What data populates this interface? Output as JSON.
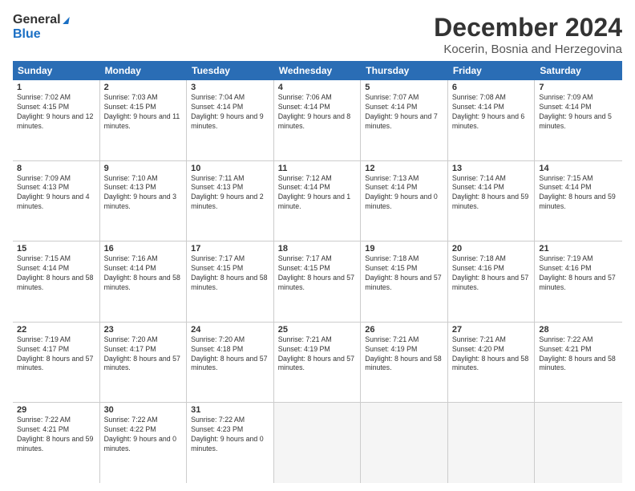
{
  "logo": {
    "line1": "General",
    "line2": "Blue"
  },
  "title": "December 2024",
  "subtitle": "Kocerin, Bosnia and Herzegovina",
  "weekdays": [
    "Sunday",
    "Monday",
    "Tuesday",
    "Wednesday",
    "Thursday",
    "Friday",
    "Saturday"
  ],
  "weeks": [
    [
      {
        "day": "1",
        "sunrise": "Sunrise: 7:02 AM",
        "sunset": "Sunset: 4:15 PM",
        "daylight": "Daylight: 9 hours and 12 minutes."
      },
      {
        "day": "2",
        "sunrise": "Sunrise: 7:03 AM",
        "sunset": "Sunset: 4:15 PM",
        "daylight": "Daylight: 9 hours and 11 minutes."
      },
      {
        "day": "3",
        "sunrise": "Sunrise: 7:04 AM",
        "sunset": "Sunset: 4:14 PM",
        "daylight": "Daylight: 9 hours and 9 minutes."
      },
      {
        "day": "4",
        "sunrise": "Sunrise: 7:06 AM",
        "sunset": "Sunset: 4:14 PM",
        "daylight": "Daylight: 9 hours and 8 minutes."
      },
      {
        "day": "5",
        "sunrise": "Sunrise: 7:07 AM",
        "sunset": "Sunset: 4:14 PM",
        "daylight": "Daylight: 9 hours and 7 minutes."
      },
      {
        "day": "6",
        "sunrise": "Sunrise: 7:08 AM",
        "sunset": "Sunset: 4:14 PM",
        "daylight": "Daylight: 9 hours and 6 minutes."
      },
      {
        "day": "7",
        "sunrise": "Sunrise: 7:09 AM",
        "sunset": "Sunset: 4:14 PM",
        "daylight": "Daylight: 9 hours and 5 minutes."
      }
    ],
    [
      {
        "day": "8",
        "sunrise": "Sunrise: 7:09 AM",
        "sunset": "Sunset: 4:13 PM",
        "daylight": "Daylight: 9 hours and 4 minutes."
      },
      {
        "day": "9",
        "sunrise": "Sunrise: 7:10 AM",
        "sunset": "Sunset: 4:13 PM",
        "daylight": "Daylight: 9 hours and 3 minutes."
      },
      {
        "day": "10",
        "sunrise": "Sunrise: 7:11 AM",
        "sunset": "Sunset: 4:13 PM",
        "daylight": "Daylight: 9 hours and 2 minutes."
      },
      {
        "day": "11",
        "sunrise": "Sunrise: 7:12 AM",
        "sunset": "Sunset: 4:14 PM",
        "daylight": "Daylight: 9 hours and 1 minute."
      },
      {
        "day": "12",
        "sunrise": "Sunrise: 7:13 AM",
        "sunset": "Sunset: 4:14 PM",
        "daylight": "Daylight: 9 hours and 0 minutes."
      },
      {
        "day": "13",
        "sunrise": "Sunrise: 7:14 AM",
        "sunset": "Sunset: 4:14 PM",
        "daylight": "Daylight: 8 hours and 59 minutes."
      },
      {
        "day": "14",
        "sunrise": "Sunrise: 7:15 AM",
        "sunset": "Sunset: 4:14 PM",
        "daylight": "Daylight: 8 hours and 59 minutes."
      }
    ],
    [
      {
        "day": "15",
        "sunrise": "Sunrise: 7:15 AM",
        "sunset": "Sunset: 4:14 PM",
        "daylight": "Daylight: 8 hours and 58 minutes."
      },
      {
        "day": "16",
        "sunrise": "Sunrise: 7:16 AM",
        "sunset": "Sunset: 4:14 PM",
        "daylight": "Daylight: 8 hours and 58 minutes."
      },
      {
        "day": "17",
        "sunrise": "Sunrise: 7:17 AM",
        "sunset": "Sunset: 4:15 PM",
        "daylight": "Daylight: 8 hours and 58 minutes."
      },
      {
        "day": "18",
        "sunrise": "Sunrise: 7:17 AM",
        "sunset": "Sunset: 4:15 PM",
        "daylight": "Daylight: 8 hours and 57 minutes."
      },
      {
        "day": "19",
        "sunrise": "Sunrise: 7:18 AM",
        "sunset": "Sunset: 4:15 PM",
        "daylight": "Daylight: 8 hours and 57 minutes."
      },
      {
        "day": "20",
        "sunrise": "Sunrise: 7:18 AM",
        "sunset": "Sunset: 4:16 PM",
        "daylight": "Daylight: 8 hours and 57 minutes."
      },
      {
        "day": "21",
        "sunrise": "Sunrise: 7:19 AM",
        "sunset": "Sunset: 4:16 PM",
        "daylight": "Daylight: 8 hours and 57 minutes."
      }
    ],
    [
      {
        "day": "22",
        "sunrise": "Sunrise: 7:19 AM",
        "sunset": "Sunset: 4:17 PM",
        "daylight": "Daylight: 8 hours and 57 minutes."
      },
      {
        "day": "23",
        "sunrise": "Sunrise: 7:20 AM",
        "sunset": "Sunset: 4:17 PM",
        "daylight": "Daylight: 8 hours and 57 minutes."
      },
      {
        "day": "24",
        "sunrise": "Sunrise: 7:20 AM",
        "sunset": "Sunset: 4:18 PM",
        "daylight": "Daylight: 8 hours and 57 minutes."
      },
      {
        "day": "25",
        "sunrise": "Sunrise: 7:21 AM",
        "sunset": "Sunset: 4:19 PM",
        "daylight": "Daylight: 8 hours and 57 minutes."
      },
      {
        "day": "26",
        "sunrise": "Sunrise: 7:21 AM",
        "sunset": "Sunset: 4:19 PM",
        "daylight": "Daylight: 8 hours and 58 minutes."
      },
      {
        "day": "27",
        "sunrise": "Sunrise: 7:21 AM",
        "sunset": "Sunset: 4:20 PM",
        "daylight": "Daylight: 8 hours and 58 minutes."
      },
      {
        "day": "28",
        "sunrise": "Sunrise: 7:22 AM",
        "sunset": "Sunset: 4:21 PM",
        "daylight": "Daylight: 8 hours and 58 minutes."
      }
    ],
    [
      {
        "day": "29",
        "sunrise": "Sunrise: 7:22 AM",
        "sunset": "Sunset: 4:21 PM",
        "daylight": "Daylight: 8 hours and 59 minutes."
      },
      {
        "day": "30",
        "sunrise": "Sunrise: 7:22 AM",
        "sunset": "Sunset: 4:22 PM",
        "daylight": "Daylight: 9 hours and 0 minutes."
      },
      {
        "day": "31",
        "sunrise": "Sunrise: 7:22 AM",
        "sunset": "Sunset: 4:23 PM",
        "daylight": "Daylight: 9 hours and 0 minutes."
      },
      {
        "day": "",
        "sunrise": "",
        "sunset": "",
        "daylight": ""
      },
      {
        "day": "",
        "sunrise": "",
        "sunset": "",
        "daylight": ""
      },
      {
        "day": "",
        "sunrise": "",
        "sunset": "",
        "daylight": ""
      },
      {
        "day": "",
        "sunrise": "",
        "sunset": "",
        "daylight": ""
      }
    ]
  ]
}
